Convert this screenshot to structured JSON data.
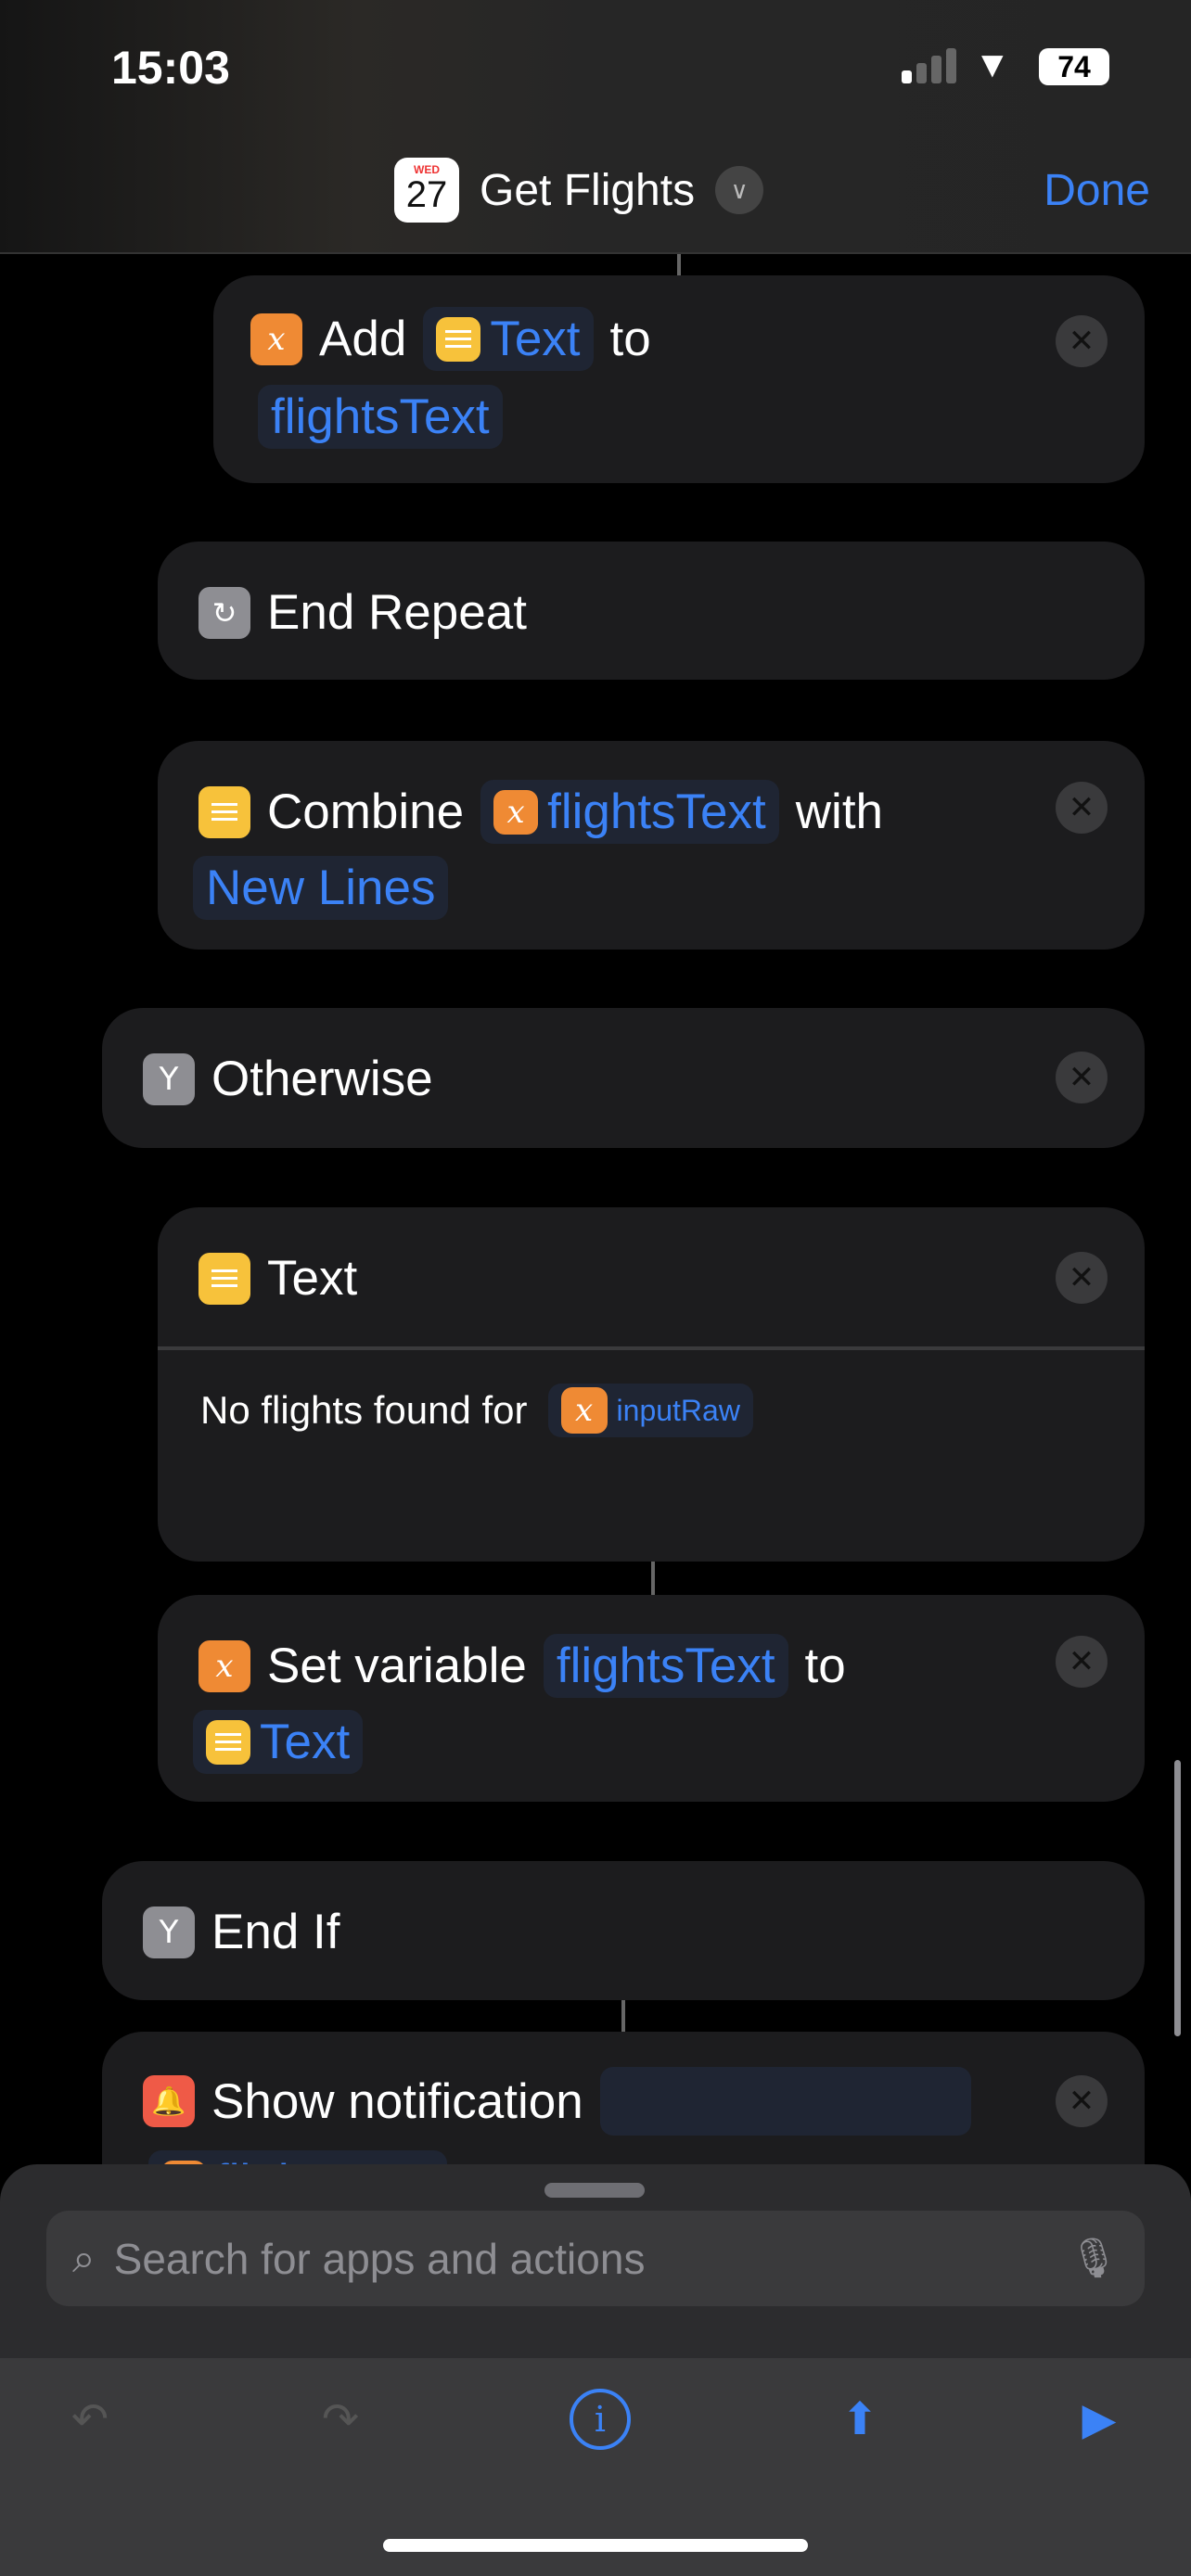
{
  "status_bar": {
    "time": "15:03",
    "battery": "74"
  },
  "header": {
    "calendar_day": "WED",
    "calendar_date": "27",
    "title": "Get Flights",
    "done_label": "Done"
  },
  "actions": [
    {
      "verb": "Add",
      "token": "Text",
      "mid": "to",
      "var": "flightsText"
    },
    {
      "label": "End Repeat"
    },
    {
      "verb": "Combine",
      "token": "flightsText",
      "mid": "with",
      "token2": "New Lines"
    },
    {
      "label": "Otherwise"
    },
    {
      "label": "Text",
      "body": "No flights found for",
      "token": "inputRaw"
    },
    {
      "verb": "Set variable",
      "var": "flightsText",
      "mid": "to",
      "token": "Text"
    },
    {
      "label": "End If"
    },
    {
      "label": "Show notification",
      "token": "flightsText"
    }
  ],
  "search": {
    "placeholder": "Search for apps and actions"
  },
  "colors": {
    "accent": "#3b82f6",
    "variable": "#ef8a34",
    "text": "#f7c23b",
    "notification": "#ef5a47"
  }
}
